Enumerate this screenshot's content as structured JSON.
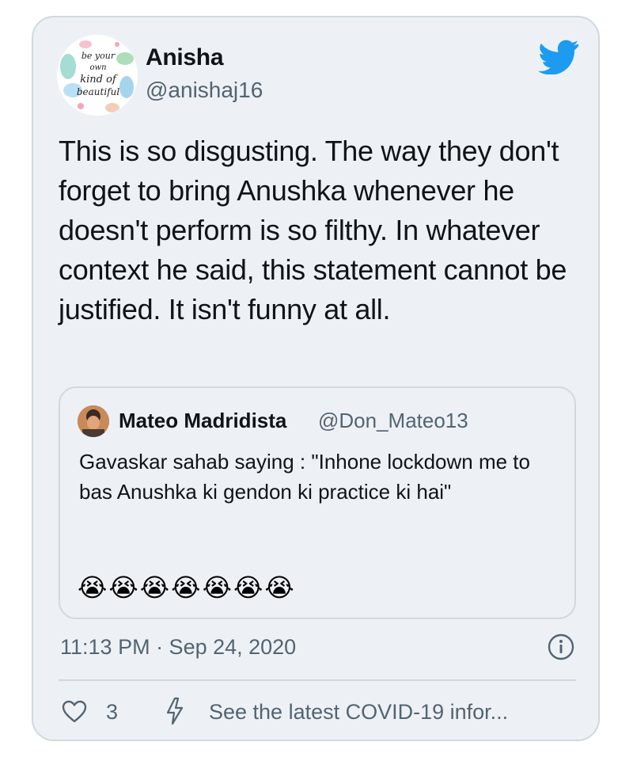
{
  "author": {
    "name": "Anisha",
    "handle": "@anishaj16",
    "avatar_text": "be your own kind of beautiful"
  },
  "tweet": {
    "text": "This is so disgusting. The way they don't forget to bring Anushka whenever he doesn't perform is so filthy. In whatever context he said, this statement cannot be justified. It isn't funny at all."
  },
  "quoted_tweet": {
    "name": "Mateo Madridista",
    "handle": "@Don_Mateo13",
    "text": "Gavaskar sahab saying : \"Inhone lockdown me to bas Anushka ki gendon ki practice ki hai\"",
    "emoji": "😭😭😭😭😭😭😭"
  },
  "meta": {
    "timestamp": "11:13 PM · Sep 24, 2020"
  },
  "actions": {
    "like_count": "3",
    "covid_link": "See the latest COVID-19 infor..."
  },
  "icons": {
    "brand": "twitter-bird-icon",
    "info": "info-icon",
    "like": "heart-icon",
    "covid": "lightning-bolt-icon"
  },
  "colors": {
    "card_bg": "#edf1f5",
    "border": "#cfd9de",
    "twitter_blue": "#1d9bf0",
    "text_primary": "#0f1419",
    "text_secondary": "#536471"
  }
}
